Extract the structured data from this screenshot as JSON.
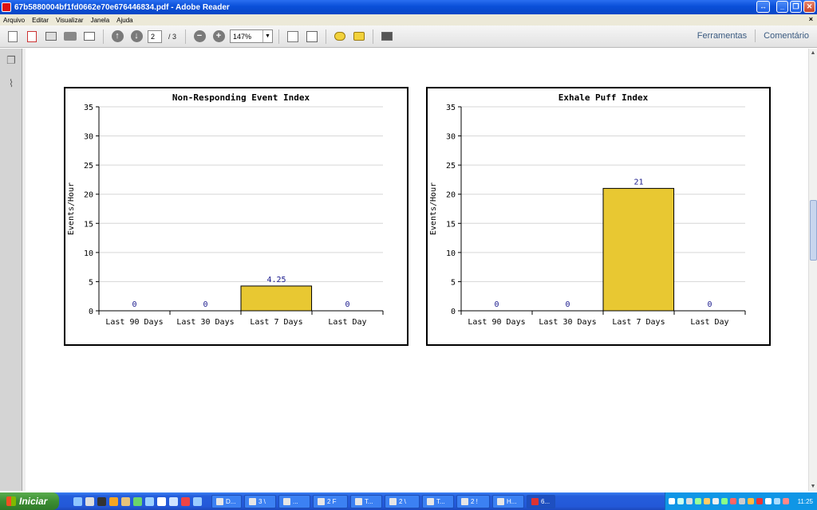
{
  "window": {
    "title": "67b5880004bf1fd0662e70e676446834.pdf - Adobe Reader"
  },
  "menu": {
    "items": [
      "Arquivo",
      "Editar",
      "Visualizar",
      "Janela",
      "Ajuda"
    ],
    "close": "×"
  },
  "toolbar": {
    "page_current": "2",
    "page_total": "/ 3",
    "zoom": "147%",
    "tools_label": "Ferramentas",
    "comment_label": "Comentário"
  },
  "taskbar": {
    "start_label": "Iniciar",
    "tasks": [
      "D...",
      "3 \\",
      "...",
      "2 F",
      "T...",
      "2 \\",
      "T...",
      "2 !",
      "H...",
      "6..."
    ],
    "clock": "11:25"
  },
  "chart_data": [
    {
      "type": "bar",
      "title": "Non-Responding Event Index",
      "ylabel": "Events/Hour",
      "xlabel": "",
      "categories": [
        "Last 90 Days",
        "Last 30 Days",
        "Last 7 Days",
        "Last Day"
      ],
      "values": [
        0,
        0,
        4.25,
        0
      ],
      "value_labels": [
        "0",
        "0",
        "4.25",
        "0"
      ],
      "ylim": [
        0,
        35
      ],
      "yticks": [
        0,
        5,
        10,
        15,
        20,
        25,
        30,
        35
      ],
      "grid": true,
      "bar_color": "#e8c832"
    },
    {
      "type": "bar",
      "title": "Exhale Puff Index",
      "ylabel": "Events/Hour",
      "xlabel": "",
      "categories": [
        "Last 90 Days",
        "Last 30 Days",
        "Last 7 Days",
        "Last Day"
      ],
      "values": [
        0,
        0,
        21,
        0
      ],
      "value_labels": [
        "0",
        "0",
        "21",
        "0"
      ],
      "ylim": [
        0,
        35
      ],
      "yticks": [
        0,
        5,
        10,
        15,
        20,
        25,
        30,
        35
      ],
      "grid": true,
      "bar_color": "#e8c832"
    }
  ]
}
